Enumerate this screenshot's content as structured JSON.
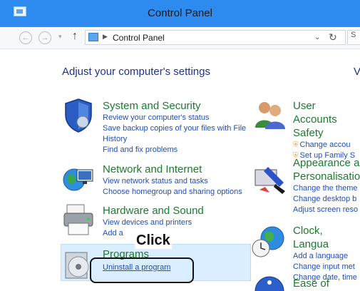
{
  "window": {
    "title": "Control Panel"
  },
  "address": {
    "path": "Control Panel",
    "search_fragment": "S"
  },
  "main": {
    "heading": "Adjust your computer's settings",
    "heading_right_fragment": "V"
  },
  "categories": {
    "system": {
      "title": "System and Security",
      "links": [
        "Review your computer's status",
        "Save backup copies of your files with File",
        "History",
        "Find and fix problems"
      ]
    },
    "network": {
      "title": "Network and Internet",
      "links": [
        "View network status and tasks",
        "Choose homegroup and sharing options"
      ]
    },
    "hardware": {
      "title": "Hardware and Sound",
      "links": [
        "View devices and printers",
        "Add a"
      ]
    },
    "programs": {
      "title": "Programs",
      "links": [
        "Uninstall a program"
      ]
    },
    "user": {
      "title_lines": [
        "User Accounts",
        "Safety"
      ],
      "links": [
        "Change accou",
        "Set up Family S"
      ]
    },
    "appearance": {
      "title_lines": [
        "Appearance a",
        "Personalisatio"
      ],
      "links": [
        "Change the theme",
        "Change desktop b",
        "Adjust screen reso"
      ]
    },
    "clock": {
      "title": "Clock, Langua",
      "links": [
        "Add a language",
        "Change input met",
        "Change date, time"
      ]
    },
    "ease": {
      "title": "Ease of Access"
    }
  },
  "callout": {
    "label": "Click"
  }
}
